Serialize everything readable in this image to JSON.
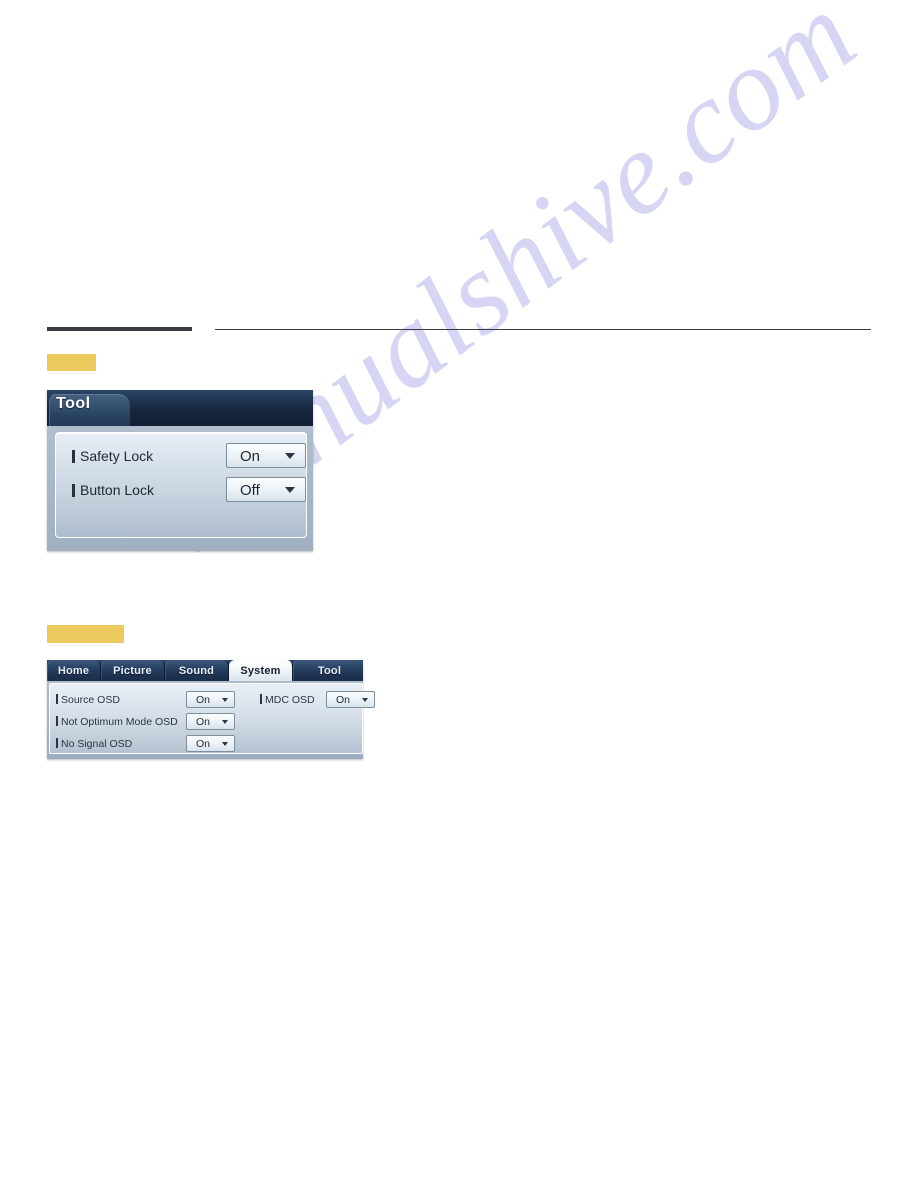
{
  "page": {
    "watermark_text": "manualshive.com",
    "background_color": "#ffffff",
    "rule_color": "#3b3b42",
    "highlight_color": "#ecca5e"
  },
  "tool_panel": {
    "tab_label": "Tool",
    "rows": [
      {
        "label": "Safety Lock",
        "value": "On",
        "icon": "chevron-down-icon"
      },
      {
        "label": "Button Lock",
        "value": "Off",
        "icon": "chevron-down-icon"
      }
    ]
  },
  "system_panel": {
    "tabs": [
      {
        "label": "Home",
        "active": false
      },
      {
        "label": "Picture",
        "active": false
      },
      {
        "label": "Sound",
        "active": false
      },
      {
        "label": "System",
        "active": true
      },
      {
        "label": "Tool",
        "active": false
      }
    ],
    "rows_left": [
      {
        "label": "Source OSD",
        "value": "On",
        "icon": "chevron-down-icon"
      },
      {
        "label": "Not Optimum Mode OSD",
        "value": "On",
        "icon": "chevron-down-icon"
      },
      {
        "label": "No Signal OSD",
        "value": "On",
        "icon": "chevron-down-icon"
      }
    ],
    "rows_right": [
      {
        "label": "MDC OSD",
        "value": "On",
        "icon": "chevron-down-icon"
      }
    ]
  }
}
